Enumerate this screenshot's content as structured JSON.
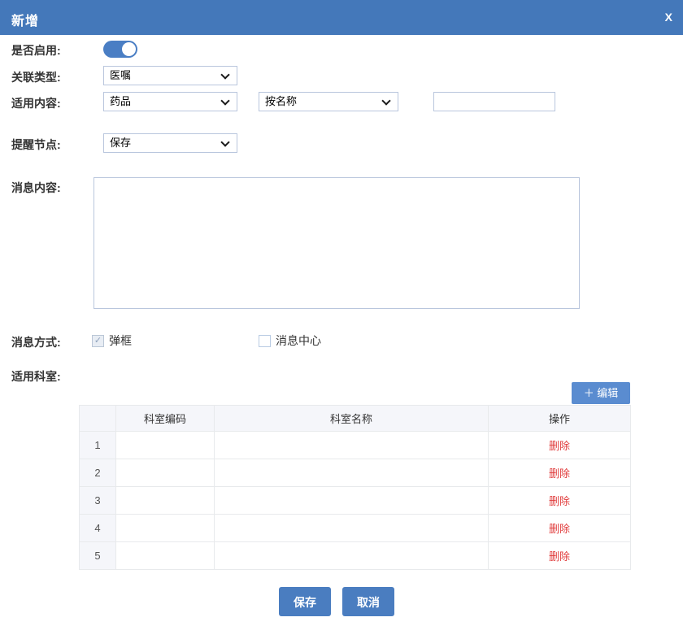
{
  "dialog": {
    "title": "新增",
    "close_label": "X"
  },
  "form": {
    "enable_label": "是否启用:",
    "enable_state": "on",
    "relation_label": "关联类型:",
    "relation_value": "医嘱",
    "content_label": "适用内容:",
    "content_type_value": "药品",
    "content_match_value": "按名称",
    "content_keyword_value": "",
    "remind_label": "提醒节点:",
    "remind_value": "保存",
    "message_label": "消息内容:",
    "message_value": "",
    "mode_label": "消息方式:",
    "mode_options": [
      {
        "label": "弹框",
        "checked": true
      },
      {
        "label": "消息中心",
        "checked": false
      }
    ],
    "dept_label": "适用科室:",
    "edit_button_label": "＋ 编辑"
  },
  "icons": {
    "check": "✓",
    "chevron": "chevron-down"
  },
  "table": {
    "headers": {
      "index": "",
      "code": "科室编码",
      "name": "科室名称",
      "action": "操作"
    },
    "rows": [
      {
        "index": "1",
        "code": "",
        "name": "",
        "action": "删除"
      },
      {
        "index": "2",
        "code": "",
        "name": "",
        "action": "删除"
      },
      {
        "index": "3",
        "code": "",
        "name": "",
        "action": "删除"
      },
      {
        "index": "4",
        "code": "",
        "name": "",
        "action": "删除"
      },
      {
        "index": "5",
        "code": "",
        "name": "",
        "action": "删除"
      }
    ]
  },
  "footer": {
    "save_label": "保存",
    "cancel_label": "取消"
  },
  "colors": {
    "titlebar": "#4478ba",
    "primary_button": "#4a7dc0",
    "edit_button": "#5a8cd0",
    "delete_link": "#e03c3c",
    "toggle_on": "#4a7ec4",
    "border_input": "#b9c6dd",
    "table_header_bg": "#f5f6fa"
  }
}
